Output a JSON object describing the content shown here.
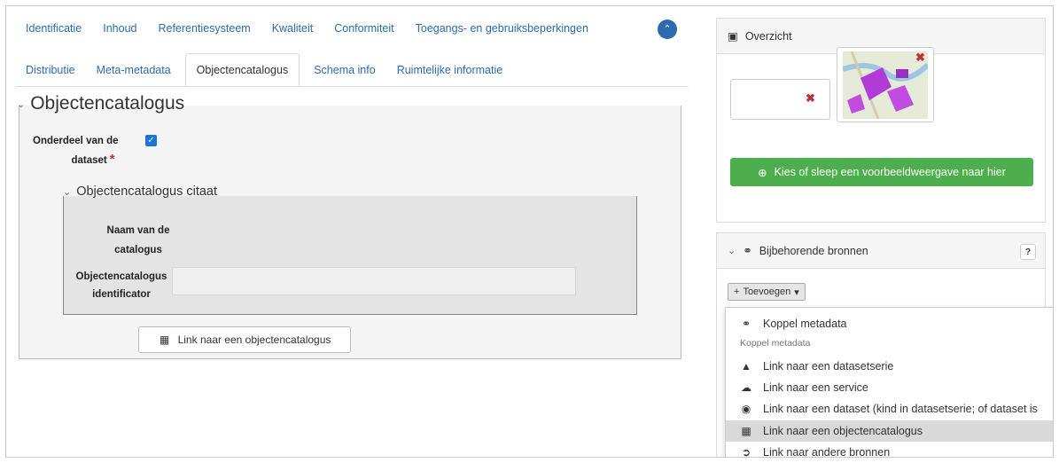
{
  "tabs_row1": [
    "Identificatie",
    "Inhoud",
    "Referentiesysteem",
    "Kwaliteit",
    "Conformiteit",
    "Toegangs- en gebruiksbeperkingen"
  ],
  "tabs_row2": [
    "Distributie",
    "Meta-metadata",
    "Objectencatalogus",
    "Schema info",
    "Ruimtelijke informatie"
  ],
  "active_tab": "Objectencatalogus",
  "section": {
    "title": "Objectencatalogus",
    "field_onderdeel_line1": "Onderdeel van de",
    "field_onderdeel_line2": "dataset",
    "required_mark": "*",
    "subsection_title": "Objectencatalogus citaat",
    "field_naam_line1": "Naam van de",
    "field_naam_line2": "catalogus",
    "field_ident_line1": "Objectencatalogus",
    "field_ident_line2": "identificator",
    "link_button": "Link naar een objectencatalogus"
  },
  "overview": {
    "title": "Overzicht",
    "button": "Kies of sleep een voorbeeldweergave naar hier"
  },
  "related": {
    "title": "Bijbehorende bronnen",
    "add_button": "Toevoegen",
    "help": "?",
    "menu": {
      "item_koppel": "Koppel metadata",
      "header": "Koppel metadata",
      "items": [
        "Link naar een datasetserie",
        "Link naar een service",
        "Link naar een dataset (kind in datasetserie; of dataset is",
        "Link naar een objectencatalogus",
        "Link naar andere bronnen"
      ]
    }
  },
  "colors": {
    "link_blue": "#2b6cb0",
    "green": "#4cae4c",
    "checkbox_blue": "#1e73d9",
    "required_red": "#c0392b"
  }
}
